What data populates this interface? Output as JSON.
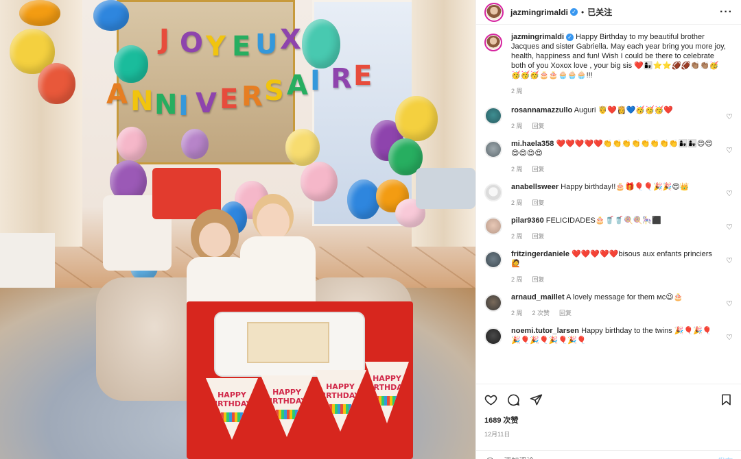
{
  "post": {
    "username": "jazmingrimaldi",
    "follow_status": "已关注",
    "more_glyph": "···",
    "caption": "Happy Birthday to my beautiful brother Jacques and sister Gabriella. May each year bring you more joy, health, happiness and fun! Wish I could be there to celebrate both of you Xoxox love , your big sis ❤️👩‍👧⭐⭐🏈🏈👏🏽👏🏽🥳🥳🥳🥳🎂🎂🧁🧁🧁!!!",
    "caption_time": "2 周",
    "likes": "1689 次赞",
    "date": "12月11日",
    "add_comment_placeholder": "添加评论……",
    "post_button": "发布"
  },
  "photo": {
    "banner_line1": [
      "J",
      "O",
      "Y",
      "E",
      "U",
      "X"
    ],
    "banner_line2": [
      "A",
      "N",
      "N",
      "I",
      "V",
      "E",
      "R",
      "S",
      "A",
      "I",
      "R",
      "E"
    ],
    "pennant_text": "HAPPY BIRTHDAY!"
  },
  "comments": [
    {
      "user": "rosannamazzullo",
      "text": "Auguri 🤴❤️👸💙🥳🥳🥳❤️",
      "time": "2 周",
      "reply": "回复",
      "likes": ""
    },
    {
      "user": "mi.haela358",
      "text": "❤️❤️❤️❤️❤️👏👏👏👏👏👏👏👏👩‍👧👩‍👧😍😍😍😍😍😍",
      "time": "2 周",
      "reply": "回复",
      "likes": ""
    },
    {
      "user": "anabellsweer",
      "text": "Happy birthday!!🎂🎁🎈🎈🎉🎉😍👑",
      "time": "2 周",
      "reply": "回复",
      "likes": ""
    },
    {
      "user": "pilar9360",
      "text": "FELICIDADES🎂🥤🥤🍭🍭🎠⬛",
      "time": "2 周",
      "reply": "回复",
      "likes": ""
    },
    {
      "user": "fritzingerdaniele",
      "text": "❤️❤️❤️❤️❤️bisous aux enfants princiers 🙋",
      "time": "2 周",
      "reply": "回复",
      "likes": ""
    },
    {
      "user": "arnaud_maillet",
      "text": "A lovely message for them ᴍᴄ😉🎂",
      "time": "2 周",
      "reply": "回复",
      "likes": "2 次赞"
    },
    {
      "user": "noemi.tutor_larsen",
      "text": "Happy birthday to the twins 🎉🎈🎉🎈🎉🎈🎉🎈🎉🎈🎉🎈",
      "time": "",
      "reply": "",
      "likes": ""
    }
  ]
}
